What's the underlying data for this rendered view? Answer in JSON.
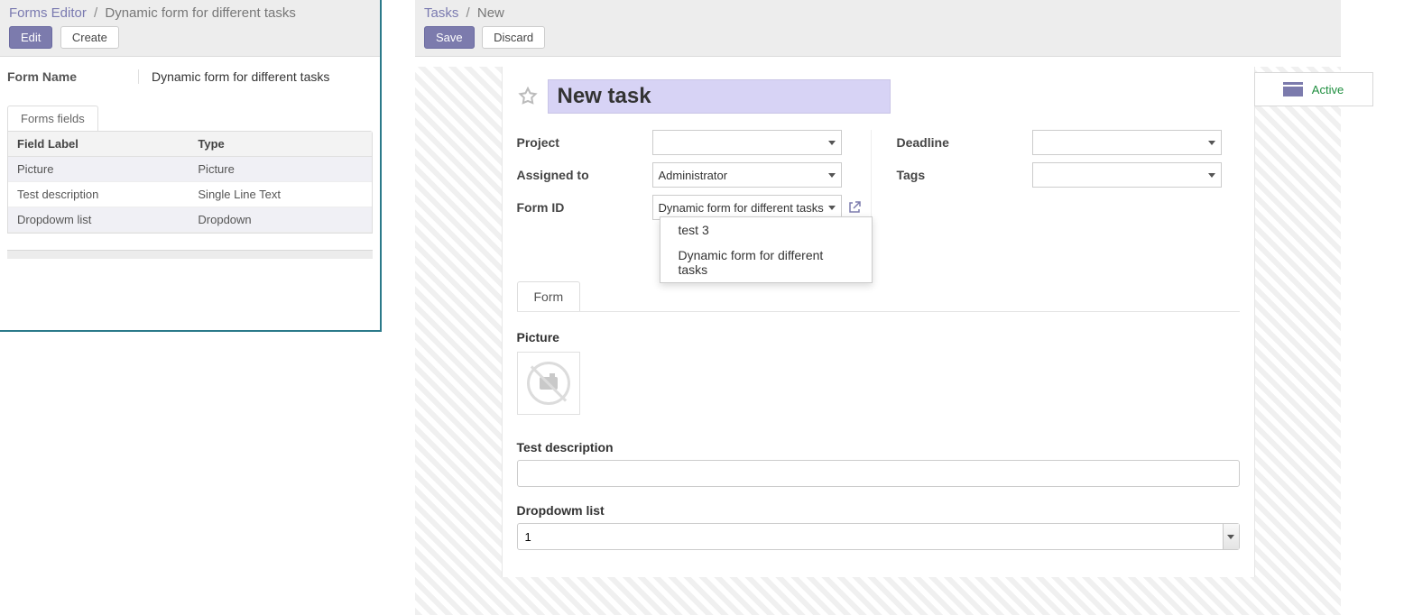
{
  "left": {
    "breadcrumb_root": "Forms Editor",
    "breadcrumb_sep": "/",
    "breadcrumb_current": "Dynamic form for different tasks",
    "btn_edit": "Edit",
    "btn_create": "Create",
    "form_name_label": "Form Name",
    "form_name_value": "Dynamic form for different tasks",
    "tab_label": "Forms fields",
    "columns": {
      "label": "Field Label",
      "type": "Type"
    },
    "rows": [
      {
        "label": "Picture",
        "type": "Picture"
      },
      {
        "label": "Test description",
        "type": "Single Line Text"
      },
      {
        "label": "Dropdowm list",
        "type": "Dropdown"
      }
    ]
  },
  "right": {
    "breadcrumb_root": "Tasks",
    "breadcrumb_sep": "/",
    "breadcrumb_current": "New",
    "btn_save": "Save",
    "btn_discard": "Discard",
    "status_label": "Active",
    "title_value": "New task",
    "labels": {
      "project": "Project",
      "assigned": "Assigned to",
      "formid": "Form ID",
      "deadline": "Deadline",
      "tags": "Tags"
    },
    "values": {
      "project": "",
      "assigned": "Administrator",
      "formid": "Dynamic form for different tasks",
      "deadline": "",
      "tags": ""
    },
    "formid_options": [
      "test 3",
      "Dynamic form for different tasks"
    ],
    "tab_form": "Form",
    "section_picture": "Picture",
    "section_desc": "Test description",
    "desc_value": "",
    "section_dropdown": "Dropdowm list",
    "dropdown_value": "1"
  }
}
